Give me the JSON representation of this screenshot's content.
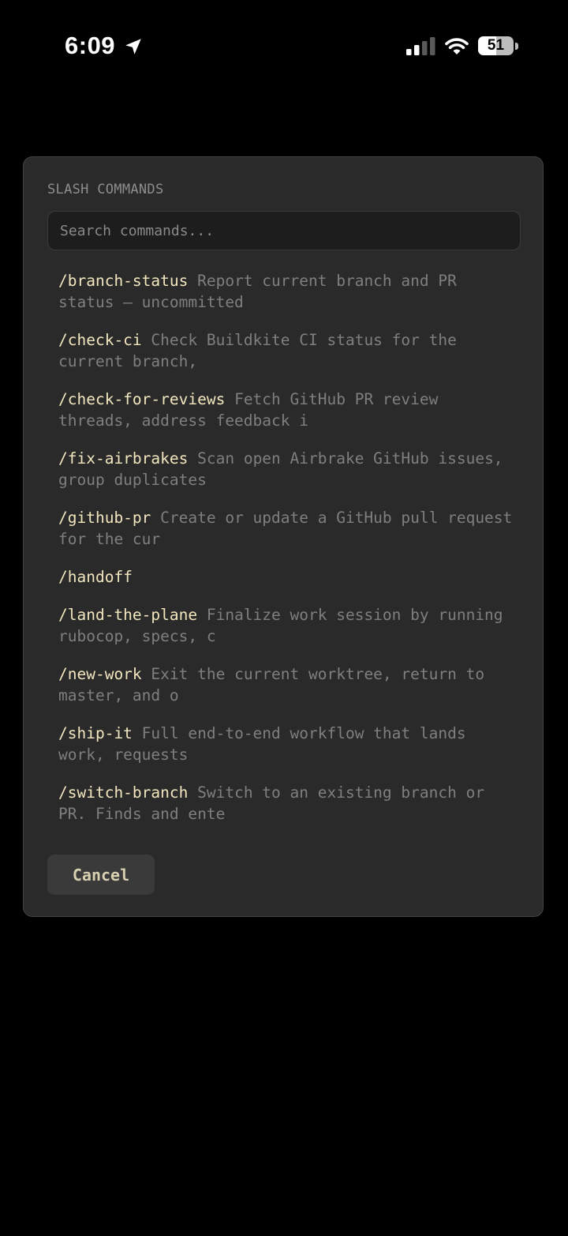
{
  "status_bar": {
    "time": "6:09",
    "battery_level": "51",
    "battery_fraction": 0.51,
    "icons": [
      "location-arrow-icon",
      "cellular-signal-icon",
      "wifi-icon",
      "battery-icon"
    ]
  },
  "dialog": {
    "title": "SLASH COMMANDS",
    "search": {
      "placeholder": "Search commands...",
      "value": ""
    },
    "commands": [
      {
        "name": "/branch-status",
        "description": "Report current branch and PR status — uncommitted"
      },
      {
        "name": "/check-ci",
        "description": "Check Buildkite CI status for the current branch,"
      },
      {
        "name": "/check-for-reviews",
        "description": "Fetch GitHub PR review threads, address feedback i"
      },
      {
        "name": "/fix-airbrakes",
        "description": "Scan open Airbrake GitHub issues, group duplicates"
      },
      {
        "name": "/github-pr",
        "description": "Create or update a GitHub pull request for the cur"
      },
      {
        "name": "/handoff",
        "description": ""
      },
      {
        "name": "/land-the-plane",
        "description": "Finalize work session by running rubocop, specs, c"
      },
      {
        "name": "/new-work",
        "description": "Exit the current worktree, return to master, and o"
      },
      {
        "name": "/ship-it",
        "description": "Full end-to-end workflow that lands work, requests"
      },
      {
        "name": "/switch-branch",
        "description": "Switch to an existing branch or PR. Finds and ente"
      }
    ],
    "cancel_label": "Cancel"
  },
  "colors": {
    "background": "#000000",
    "panel": "#2a2a2a",
    "panel_border": "#434343",
    "command_name": "#f2e6bf",
    "command_description": "#7f7f7f",
    "button_text": "#d8d0b0"
  }
}
